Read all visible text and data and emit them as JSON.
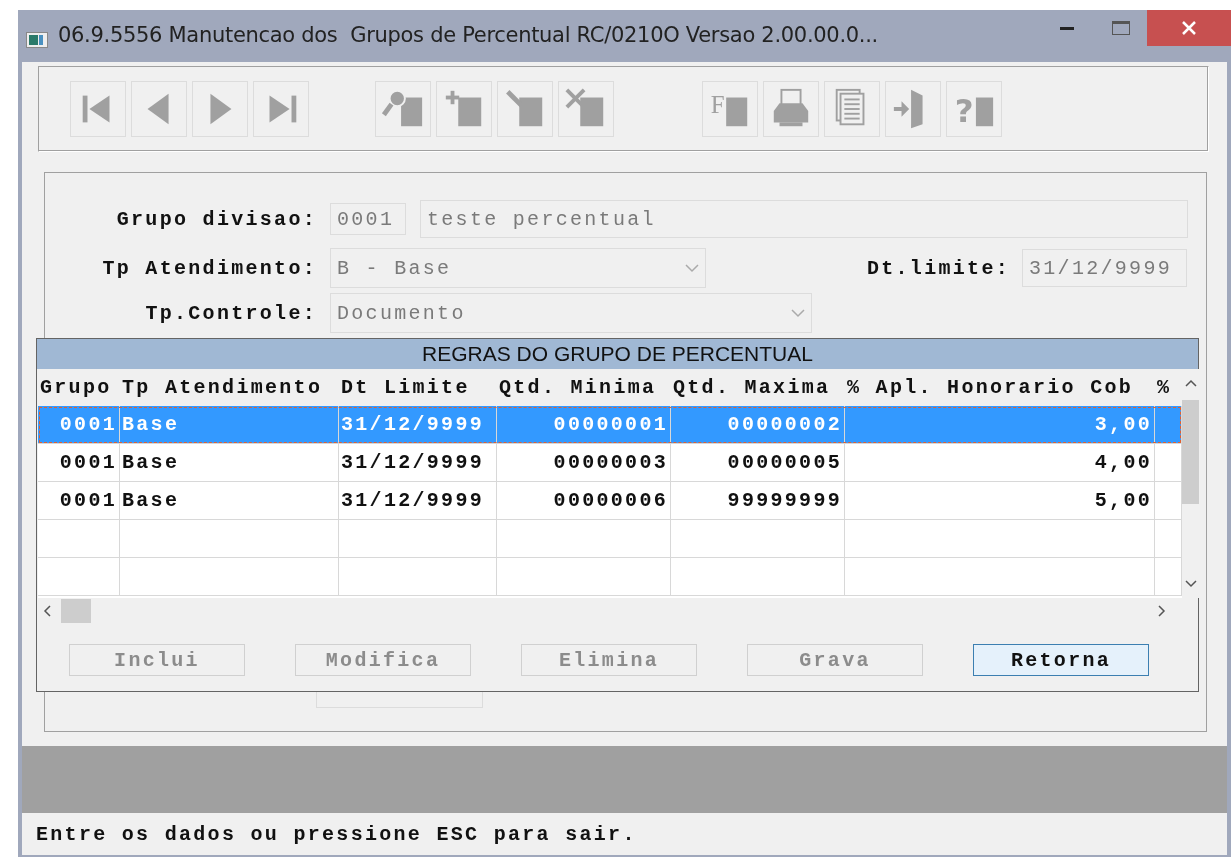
{
  "window": {
    "title": "06.9.5556 Manutencao dos  Grupos de Percentual RC/0210O Versao 2.00.00.0..."
  },
  "toolbar": {
    "groups": [
      [
        {
          "kind": "first"
        },
        {
          "kind": "prev"
        },
        {
          "kind": "next"
        },
        {
          "kind": "last"
        }
      ],
      [
        {
          "kind": "search"
        },
        {
          "kind": "add"
        },
        {
          "kind": "edit"
        },
        {
          "kind": "delete"
        }
      ],
      [
        {
          "kind": "filter",
          "glyph": "F"
        },
        {
          "kind": "print"
        },
        {
          "kind": "copy"
        },
        {
          "kind": "exit"
        },
        {
          "kind": "help",
          "glyph": "?"
        }
      ]
    ]
  },
  "form": {
    "grupo_divisao": {
      "label": "Grupo divisao:",
      "code": "0001",
      "description": "teste percentual",
      "disabled": true
    },
    "tp_atendimento": {
      "label": "Tp Atendimento:",
      "value": "B - Base",
      "disabled": true
    },
    "dt_limite": {
      "label": "Dt.limite:",
      "value": "31/12/9999",
      "disabled": true
    },
    "tp_controle": {
      "label": "Tp.Controle:",
      "value": "Documento",
      "disabled": true
    }
  },
  "dialog": {
    "title": "REGRAS DO GRUPO DE PERCENTUAL",
    "columns": [
      "Grupo",
      "Tp Atendimento",
      "Dt Limite",
      "Qtd. Minima",
      "Qtd. Maxima",
      "% Apl. Honorario Cob",
      "%"
    ],
    "rows": [
      {
        "selected": true,
        "cells": [
          "0001",
          "Base",
          "31/12/9999",
          "00000001",
          "00000002",
          "3,00"
        ]
      },
      {
        "selected": false,
        "cells": [
          "0001",
          "Base",
          "31/12/9999",
          "00000003",
          "00000005",
          "4,00"
        ]
      },
      {
        "selected": false,
        "cells": [
          "0001",
          "Base",
          "31/12/9999",
          "00000006",
          "99999999",
          "5,00"
        ]
      }
    ],
    "buttons": [
      {
        "label": "Inclui",
        "disabled": true,
        "focused": false
      },
      {
        "label": "Modifica",
        "disabled": true,
        "focused": false
      },
      {
        "label": "Elimina",
        "disabled": true,
        "focused": false
      },
      {
        "label": "Grava",
        "disabled": true,
        "focused": false
      },
      {
        "label": "Retorna",
        "disabled": false,
        "focused": true
      }
    ]
  },
  "status_bar": {
    "message": "Entre os dados ou pressione ESC para sair."
  }
}
